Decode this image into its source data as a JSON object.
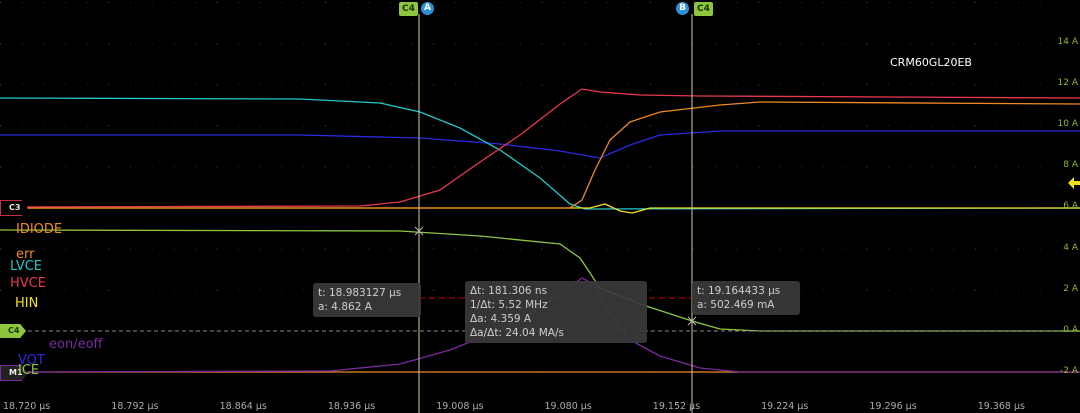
{
  "title": "CRM60GL20EB",
  "cursor_tags": {
    "a_channel": "C4",
    "a_label": "A",
    "b_label": "B",
    "b_channel": "C4"
  },
  "channel_markers": {
    "c3": "C3",
    "c4": "C4",
    "math": "M1"
  },
  "legend": [
    {
      "text": "IDIODE",
      "color": "#f08a24"
    },
    {
      "text": "err",
      "color": "#f08a24"
    },
    {
      "text": "LVCE",
      "color": "#22c8c8"
    },
    {
      "text": "HVCE",
      "color": "#e8384f"
    },
    {
      "text": "HIN",
      "color": "#f0e020"
    },
    {
      "text": "eon/eoff",
      "color": "#7a2aa0"
    },
    {
      "text": "VOT",
      "color": "#2a2ae0"
    },
    {
      "text": "ICE",
      "color": "#8cc63f"
    }
  ],
  "y_axis": [
    "14 A",
    "12 A",
    "10 A",
    "8 A",
    "6 A",
    "4 A",
    "2 A",
    "0 A",
    "-2 A"
  ],
  "x_axis": [
    "18.720 µs",
    "18.792 µs",
    "18.864 µs",
    "18.936 µs",
    "19.008 µs",
    "19.080 µs",
    "19.152 µs",
    "19.224 µs",
    "19.296 µs",
    "19.368 µs"
  ],
  "cursor_a": {
    "t": "t: 18.983127 µs",
    "a": "a: 4.862 A"
  },
  "cursor_b": {
    "t": "t: 19.164433 µs",
    "a": "a: 502.469 mA"
  },
  "delta": {
    "dt": "Δt: 181.306 ns",
    "inv_dt": "1/Δt: 5.52 MHz",
    "da": "Δa: 4.359 A",
    "da_dt": "Δa/Δt: 24.04 MA/s"
  },
  "colors": {
    "grid": "#444",
    "cursor": "#d8c8a8",
    "c4": "#8cc63f",
    "c3": "#e8384f",
    "math": "#7a2aa0"
  }
}
